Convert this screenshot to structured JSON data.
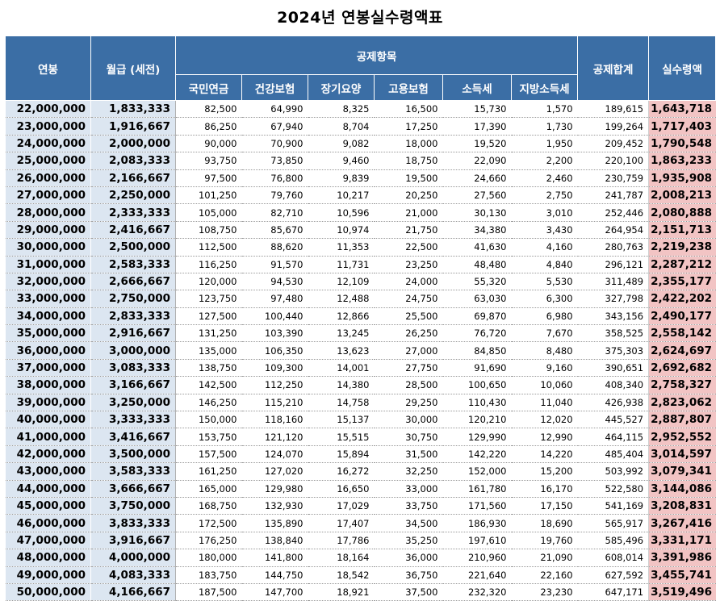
{
  "title": "2024년 연봉실수령액표",
  "headers": {
    "salary": "연봉",
    "monthly": "월급 (세전)",
    "deductions": "공제항목",
    "pension": "국민연금",
    "health": "건강보험",
    "ltc": "장기요양",
    "employment": "고용보험",
    "income_tax": "소득세",
    "local_tax": "지방소득세",
    "total": "공제합계",
    "net": "실수령액"
  },
  "rows": [
    [
      "22,000,000",
      "1,833,333",
      "82,500",
      "64,990",
      "8,325",
      "16,500",
      "15,730",
      "1,570",
      "189,615",
      "1,643,718"
    ],
    [
      "23,000,000",
      "1,916,667",
      "86,250",
      "67,940",
      "8,704",
      "17,250",
      "17,390",
      "1,730",
      "199,264",
      "1,717,403"
    ],
    [
      "24,000,000",
      "2,000,000",
      "90,000",
      "70,900",
      "9,082",
      "18,000",
      "19,520",
      "1,950",
      "209,452",
      "1,790,548"
    ],
    [
      "25,000,000",
      "2,083,333",
      "93,750",
      "73,850",
      "9,460",
      "18,750",
      "22,090",
      "2,200",
      "220,100",
      "1,863,233"
    ],
    [
      "26,000,000",
      "2,166,667",
      "97,500",
      "76,800",
      "9,839",
      "19,500",
      "24,660",
      "2,460",
      "230,759",
      "1,935,908"
    ],
    [
      "27,000,000",
      "2,250,000",
      "101,250",
      "79,760",
      "10,217",
      "20,250",
      "27,560",
      "2,750",
      "241,787",
      "2,008,213"
    ],
    [
      "28,000,000",
      "2,333,333",
      "105,000",
      "82,710",
      "10,596",
      "21,000",
      "30,130",
      "3,010",
      "252,446",
      "2,080,888"
    ],
    [
      "29,000,000",
      "2,416,667",
      "108,750",
      "85,670",
      "10,974",
      "21,750",
      "34,380",
      "3,430",
      "264,954",
      "2,151,713"
    ],
    [
      "30,000,000",
      "2,500,000",
      "112,500",
      "88,620",
      "11,353",
      "22,500",
      "41,630",
      "4,160",
      "280,763",
      "2,219,238"
    ],
    [
      "31,000,000",
      "2,583,333",
      "116,250",
      "91,570",
      "11,731",
      "23,250",
      "48,480",
      "4,840",
      "296,121",
      "2,287,212"
    ],
    [
      "32,000,000",
      "2,666,667",
      "120,000",
      "94,530",
      "12,109",
      "24,000",
      "55,320",
      "5,530",
      "311,489",
      "2,355,177"
    ],
    [
      "33,000,000",
      "2,750,000",
      "123,750",
      "97,480",
      "12,488",
      "24,750",
      "63,030",
      "6,300",
      "327,798",
      "2,422,202"
    ],
    [
      "34,000,000",
      "2,833,333",
      "127,500",
      "100,440",
      "12,866",
      "25,500",
      "69,870",
      "6,980",
      "343,156",
      "2,490,177"
    ],
    [
      "35,000,000",
      "2,916,667",
      "131,250",
      "103,390",
      "13,245",
      "26,250",
      "76,720",
      "7,670",
      "358,525",
      "2,558,142"
    ],
    [
      "36,000,000",
      "3,000,000",
      "135,000",
      "106,350",
      "13,623",
      "27,000",
      "84,850",
      "8,480",
      "375,303",
      "2,624,697"
    ],
    [
      "37,000,000",
      "3,083,333",
      "138,750",
      "109,300",
      "14,001",
      "27,750",
      "91,690",
      "9,160",
      "390,651",
      "2,692,682"
    ],
    [
      "38,000,000",
      "3,166,667",
      "142,500",
      "112,250",
      "14,380",
      "28,500",
      "100,650",
      "10,060",
      "408,340",
      "2,758,327"
    ],
    [
      "39,000,000",
      "3,250,000",
      "146,250",
      "115,210",
      "14,758",
      "29,250",
      "110,430",
      "11,040",
      "426,938",
      "2,823,062"
    ],
    [
      "40,000,000",
      "3,333,333",
      "150,000",
      "118,160",
      "15,137",
      "30,000",
      "120,210",
      "12,020",
      "445,527",
      "2,887,807"
    ],
    [
      "41,000,000",
      "3,416,667",
      "153,750",
      "121,120",
      "15,515",
      "30,750",
      "129,990",
      "12,990",
      "464,115",
      "2,952,552"
    ],
    [
      "42,000,000",
      "3,500,000",
      "157,500",
      "124,070",
      "15,894",
      "31,500",
      "142,220",
      "14,220",
      "485,404",
      "3,014,597"
    ],
    [
      "43,000,000",
      "3,583,333",
      "161,250",
      "127,020",
      "16,272",
      "32,250",
      "152,000",
      "15,200",
      "503,992",
      "3,079,341"
    ],
    [
      "44,000,000",
      "3,666,667",
      "165,000",
      "129,980",
      "16,650",
      "33,000",
      "161,780",
      "16,170",
      "522,580",
      "3,144,086"
    ],
    [
      "45,000,000",
      "3,750,000",
      "168,750",
      "132,930",
      "17,029",
      "33,750",
      "171,560",
      "17,150",
      "541,169",
      "3,208,831"
    ],
    [
      "46,000,000",
      "3,833,333",
      "172,500",
      "135,890",
      "17,407",
      "34,500",
      "186,930",
      "18,690",
      "565,917",
      "3,267,416"
    ],
    [
      "47,000,000",
      "3,916,667",
      "176,250",
      "138,840",
      "17,786",
      "35,250",
      "197,610",
      "19,760",
      "585,496",
      "3,331,171"
    ],
    [
      "48,000,000",
      "4,000,000",
      "180,000",
      "141,800",
      "18,164",
      "36,000",
      "210,960",
      "21,090",
      "608,014",
      "3,391,986"
    ],
    [
      "49,000,000",
      "4,083,333",
      "183,750",
      "144,750",
      "18,542",
      "36,750",
      "221,640",
      "22,160",
      "627,592",
      "3,455,741"
    ],
    [
      "50,000,000",
      "4,166,667",
      "187,500",
      "147,700",
      "18,921",
      "37,500",
      "232,320",
      "23,230",
      "647,171",
      "3,519,496"
    ]
  ]
}
